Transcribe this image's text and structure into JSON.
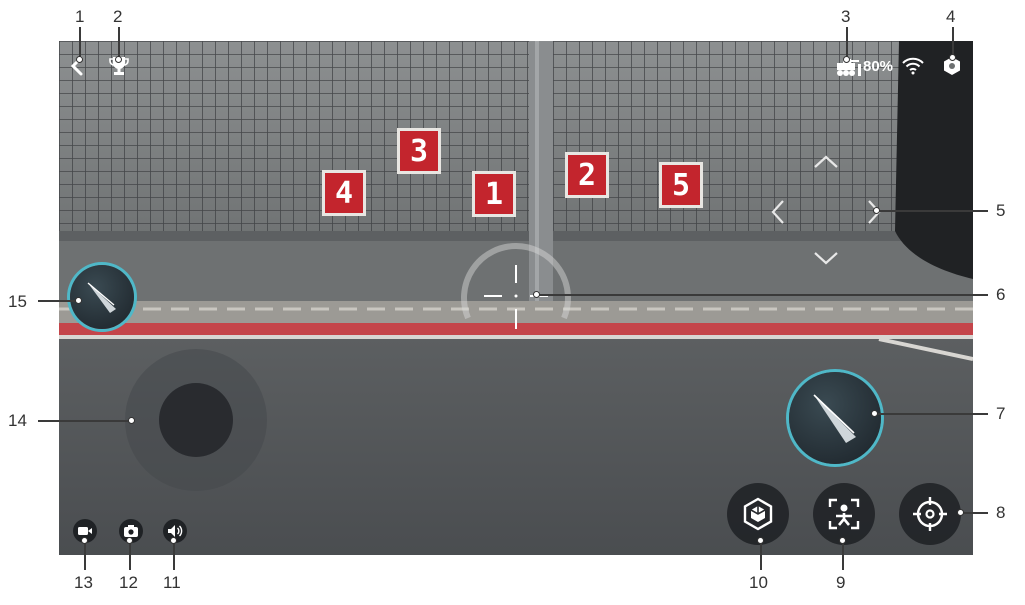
{
  "callouts": {
    "n1": "1",
    "n2": "2",
    "n3": "3",
    "n4": "4",
    "n5": "5",
    "n6": "6",
    "n7": "7",
    "n8": "8",
    "n9": "9",
    "n10": "10",
    "n11": "11",
    "n12": "12",
    "n13": "13",
    "n14": "14",
    "n15": "15"
  },
  "status_bar": {
    "battery_percent": "80%",
    "icons": [
      "back-icon",
      "trophy-icon",
      "robot-battery-icon",
      "wifi-icon",
      "settings-hexagon-icon"
    ]
  },
  "scene": {
    "targets": [
      "4",
      "3",
      "1",
      "2",
      "5"
    ],
    "target_color": "#c3252d",
    "track_stripe_color": "#c4454a"
  },
  "controls": {
    "gimbal_arrows": [
      "up",
      "left",
      "right",
      "down"
    ],
    "bottom_left_buttons": [
      "record-video-icon",
      "camera-photo-icon",
      "volume-icon"
    ],
    "bottom_right_buttons": [
      "s1-robot-icon",
      "person-recognition-icon",
      "crosshair-target-icon"
    ],
    "accent_color": "#4fb8c8"
  }
}
